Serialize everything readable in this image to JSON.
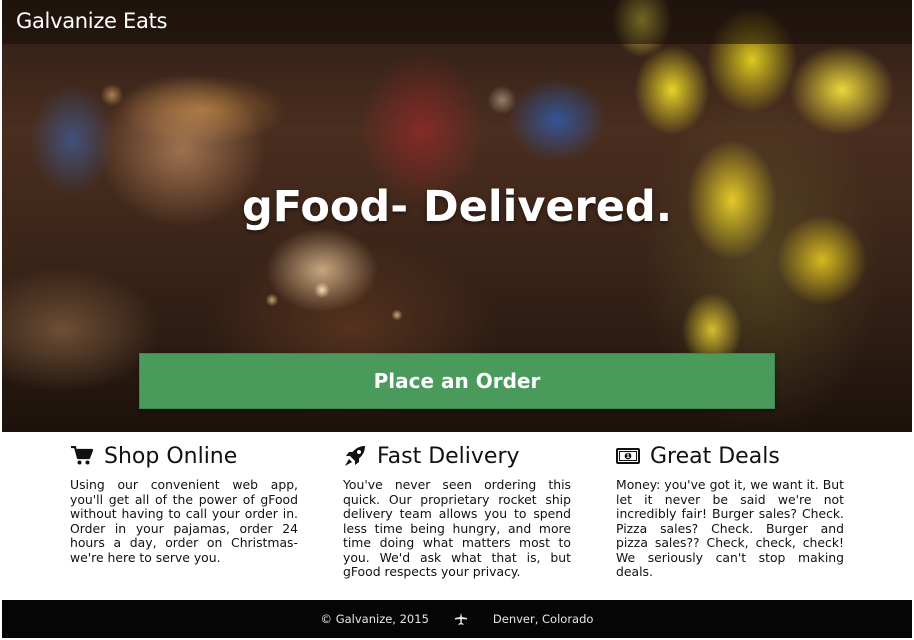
{
  "header": {
    "brand": "Galvanize Eats"
  },
  "hero": {
    "headline": "gFood- Delivered.",
    "cta_label": "Place an Order"
  },
  "features": [
    {
      "icon": "shopping-cart-icon",
      "title": "Shop Online",
      "body": "Using our convenient web app, you'll get all of the power of gFood without having to call your order in. Order in your pajamas, order 24 hours a day, order on Christmas- we're here to serve you."
    },
    {
      "icon": "rocket-icon",
      "title": "Fast Delivery",
      "body": "You've never seen ordering this quick. Our proprietary rocket ship delivery team allows you to spend less time being hungry, and more time doing what matters most to you. We'd ask what that is, but gFood respects your privacy."
    },
    {
      "icon": "money-icon",
      "title": "Great Deals",
      "body": "Money: you've got it, we want it. But let it never be said we're not incredibly fair! Burger sales? Check. Pizza sales? Check. Burger and pizza sales?? Check, check, check! We seriously can't stop making deals."
    }
  ],
  "footer": {
    "copyright": "© Galvanize, 2015",
    "separator_icon": "plane-icon",
    "location": "Denver, Colorado"
  },
  "colors": {
    "cta_green": "#4a9a5c",
    "footer_bg": "#050505"
  }
}
